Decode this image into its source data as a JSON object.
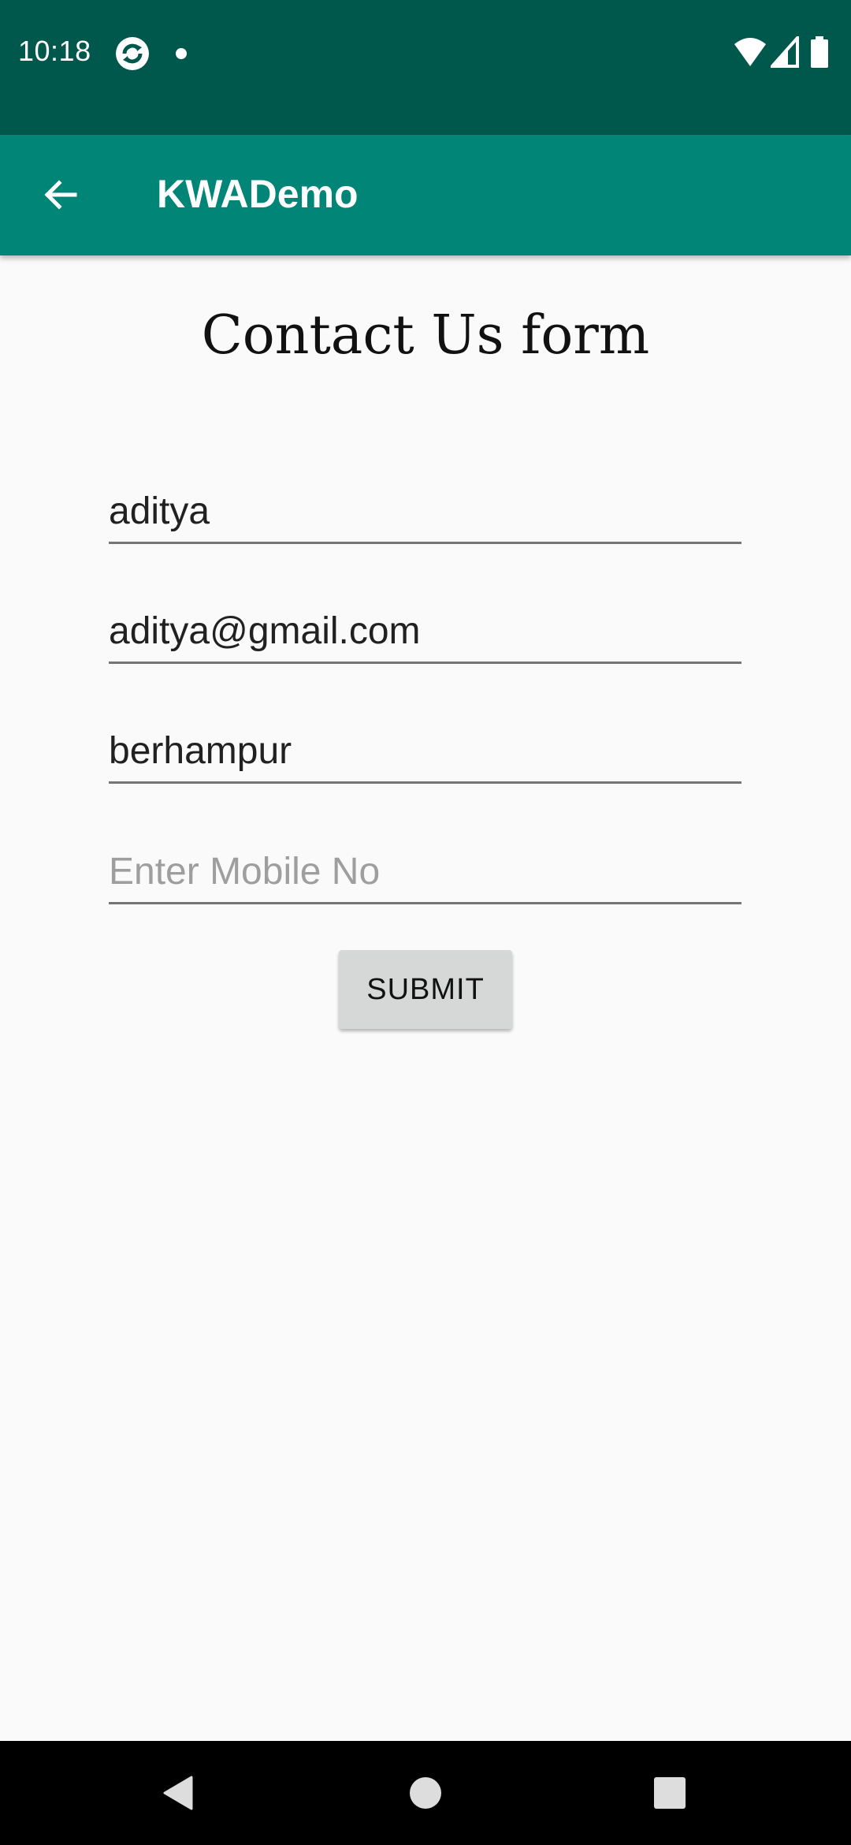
{
  "status_bar": {
    "time": "10:18",
    "icons": [
      "sync-icon",
      "notification-dot-icon",
      "wifi-icon",
      "signal-icon",
      "battery-icon"
    ]
  },
  "app_bar": {
    "title": "KWADemo",
    "back_icon": "arrow-back-icon"
  },
  "form": {
    "title": "Contact Us form",
    "fields": [
      {
        "value": "aditya",
        "placeholder": ""
      },
      {
        "value": "aditya@gmail.com",
        "placeholder": ""
      },
      {
        "value": "berhampur",
        "placeholder": ""
      },
      {
        "value": "",
        "placeholder": "Enter Mobile No"
      }
    ],
    "submit_label": "SUBMIT"
  },
  "nav_bar": {
    "icons": [
      "back-triangle-icon",
      "home-circle-icon",
      "recents-square-icon"
    ]
  },
  "colors": {
    "status_bar": "#00574b",
    "app_bar": "#008577",
    "background": "#fafafa",
    "button": "#d6d7d7"
  }
}
